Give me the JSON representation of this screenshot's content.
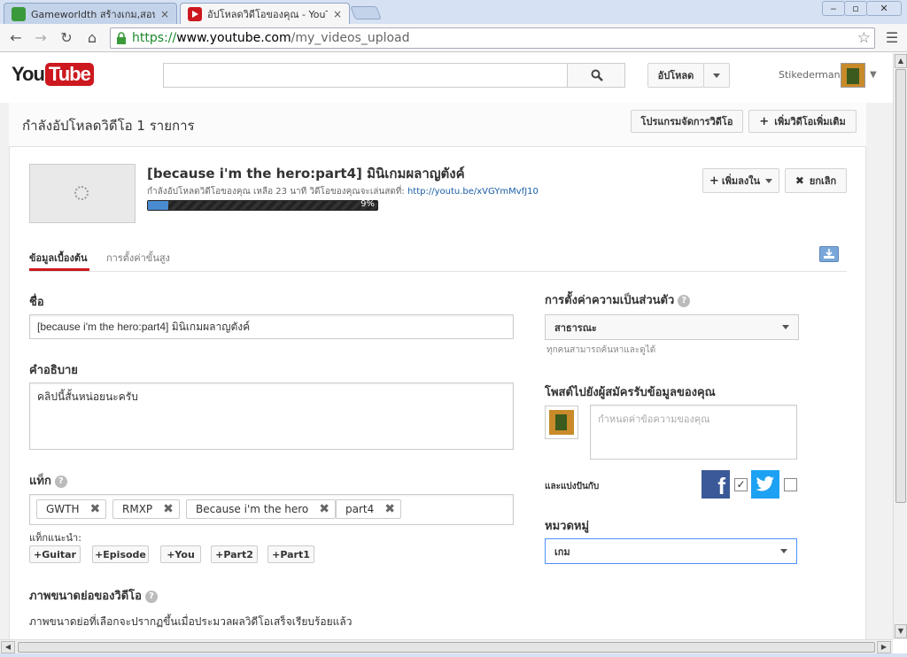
{
  "browser": {
    "tabs": [
      {
        "title": "Gameworldth สร้างเกม,สอนส",
        "icon": "frog-icon",
        "close": "×"
      },
      {
        "title": "อัปโหลดวิดีโอของคุณ - YouTu",
        "icon": "youtube-icon",
        "close": "×"
      }
    ],
    "url": {
      "scheme": "https://",
      "host": "www.youtube.com",
      "path": "/my_videos_upload"
    },
    "window_buttons": {
      "minimize": "‒",
      "maximize": "▫",
      "close": "✕"
    }
  },
  "header": {
    "logo_you": "You",
    "logo_tube": "Tube",
    "search_placeholder": "",
    "upload_label": "อัปโหลด",
    "username": "Stikederman"
  },
  "upload": {
    "heading": "กำลังอัปโหลดวิดีโอ 1 รายการ",
    "video_manager_label": "โปรแกรมจัดการวิดีโอ",
    "add_more_label": "เพิ่มวิดีโอเพิ่มเติม",
    "video_title": "[because i'm the hero:part4] มินิเกมผลาญตังค์",
    "status_text": "กำลังอัปโหลดวิดีโอของคุณ เหลือ 23 นาที วิดีโอของคุณจะเล่นสดที่: ",
    "status_link": "http://youtu.be/xVGYmMvfJ10",
    "progress_label": "9%",
    "progress": 0.09,
    "add_to_label": "เพิ่มลงใน",
    "cancel_label": "ยกเลิก"
  },
  "tabs": {
    "basic": "ข้อมูลเบื้องต้น",
    "advanced": "การตั้งค่าขั้นสูง"
  },
  "form": {
    "title_label": "ชื่อ",
    "title_value": "[because i'm the hero:part4] มินิเกมผลาญตังค์",
    "description_label": "คำอธิบาย",
    "description_value": "คลิปนี้สั้นหน่อยนะครับ",
    "tags_label": "แท็ก",
    "tags": [
      "GWTH",
      "RMXP",
      "Because i'm the hero",
      "part4"
    ],
    "suggested_label": "แท็กแนะนำ:",
    "suggested": [
      "+Guitar",
      "+Episode",
      "+You",
      "+Part2",
      "+Part1"
    ],
    "thumbs_label": "ภาพขนาดย่อของวิดีโอ",
    "thumbs_note": "ภาพขนาดย่อที่เลือกจะปรากฏขึ้นเมื่อประมวลผลวิดีโอเสร็จเรียบร้อยแล้ว"
  },
  "side": {
    "privacy_label": "การตั้งค่าความเป็นส่วนตัว",
    "privacy_value": "สาธารณะ",
    "privacy_hint": "ทุกคนสามารถค้นหาและดูได้",
    "post_label": "โพสต์ไปยังผู้สมัครรับข้อมูลของคุณ",
    "post_placeholder": "กำหนดค่าข้อความของคุณ",
    "share_label": "และแบ่งปันกับ",
    "category_label": "หมวดหมู่",
    "category_value": "เกม",
    "help": "?"
  }
}
